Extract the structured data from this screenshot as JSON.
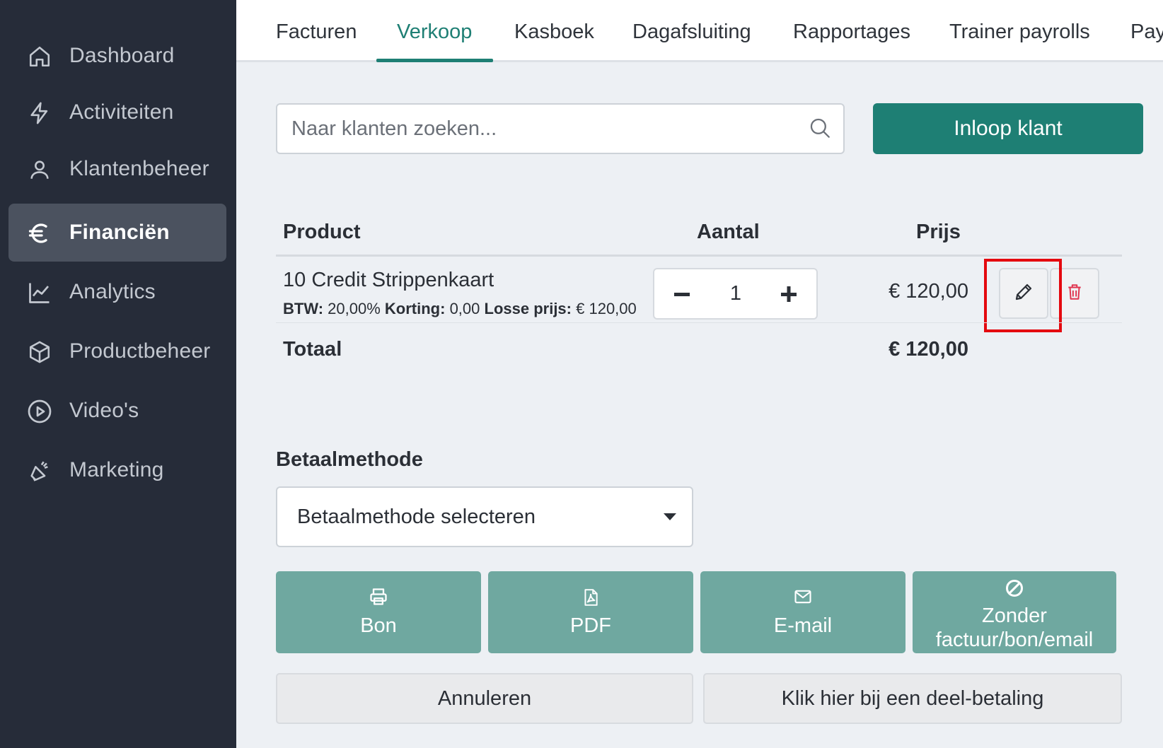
{
  "sidebar": {
    "items": [
      {
        "label": "Dashboard",
        "icon": "home-icon"
      },
      {
        "label": "Activiteiten",
        "icon": "bolt-icon"
      },
      {
        "label": "Klantenbeheer",
        "icon": "user-icon"
      },
      {
        "label": "Financiën",
        "icon": "euro-icon",
        "active": true
      },
      {
        "label": "Analytics",
        "icon": "chart-line-icon"
      },
      {
        "label": "Productbeheer",
        "icon": "box-icon"
      },
      {
        "label": "Video's",
        "icon": "play-circle-icon"
      },
      {
        "label": "Marketing",
        "icon": "megaphone-icon"
      }
    ]
  },
  "tabs": [
    {
      "label": "Facturen"
    },
    {
      "label": "Verkoop",
      "active": true
    },
    {
      "label": "Kasboek"
    },
    {
      "label": "Dagafsluiting"
    },
    {
      "label": "Rapportages"
    },
    {
      "label": "Trainer payrolls"
    },
    {
      "label": "Pay"
    }
  ],
  "search": {
    "placeholder": "Naar klanten zoeken...",
    "value": ""
  },
  "inloop_button": "Inloop klant",
  "table": {
    "headers": {
      "product": "Product",
      "quantity": "Aantal",
      "price": "Prijs"
    },
    "rows": [
      {
        "name": "10 Credit Strippenkaart",
        "btw_label": "BTW:",
        "btw_value": "20,00%",
        "korting_label": "Korting:",
        "korting_value": "0,00",
        "losse_label": "Losse prijs:",
        "losse_value": "€ 120,00",
        "quantity": "1",
        "price": "€ 120,00"
      }
    ],
    "total_label": "Totaal",
    "total_value": "€ 120,00"
  },
  "payment": {
    "title": "Betaalmethode",
    "selected": "Betaalmethode selecteren"
  },
  "actions": {
    "bon": "Bon",
    "pdf": "PDF",
    "email": "E-mail",
    "zonder_line1": "Zonder",
    "zonder_line2": "factuur/bon/email"
  },
  "footer": {
    "cancel": "Annuleren",
    "partial": "Klik hier bij een deel-betaling"
  },
  "colors": {
    "accent": "#1e7f74",
    "action": "#6fa8a0",
    "sidebar": "#262c39",
    "highlight": "#e4090f",
    "delete": "#e0344f"
  }
}
